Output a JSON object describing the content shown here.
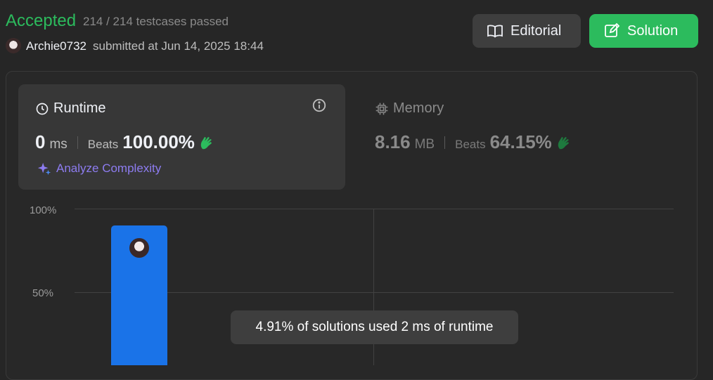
{
  "header": {
    "status": "Accepted",
    "testcases": "214 / 214 testcases passed",
    "username": "Archie0732",
    "submitted": "submitted at Jun 14, 2025 18:44",
    "editorial_label": "Editorial",
    "solution_label": "Solution"
  },
  "runtime": {
    "title": "Runtime",
    "value": "0",
    "unit": "ms",
    "beats_label": "Beats",
    "beats_value": "100.00%",
    "analyze_label": "Analyze Complexity"
  },
  "memory": {
    "title": "Memory",
    "value": "8.16",
    "unit": "MB",
    "beats_label": "Beats",
    "beats_value": "64.15%"
  },
  "colors": {
    "accepted": "#2cbb5d",
    "bar": "#1a73e8",
    "analyze": "#8d7cf0"
  },
  "chart_data": {
    "type": "bar",
    "yticks": [
      "100%",
      "50%"
    ],
    "ylim": [
      0,
      100
    ],
    "values": [
      90
    ],
    "tooltip": "4.91% of solutions used 2 ms of runtime"
  }
}
